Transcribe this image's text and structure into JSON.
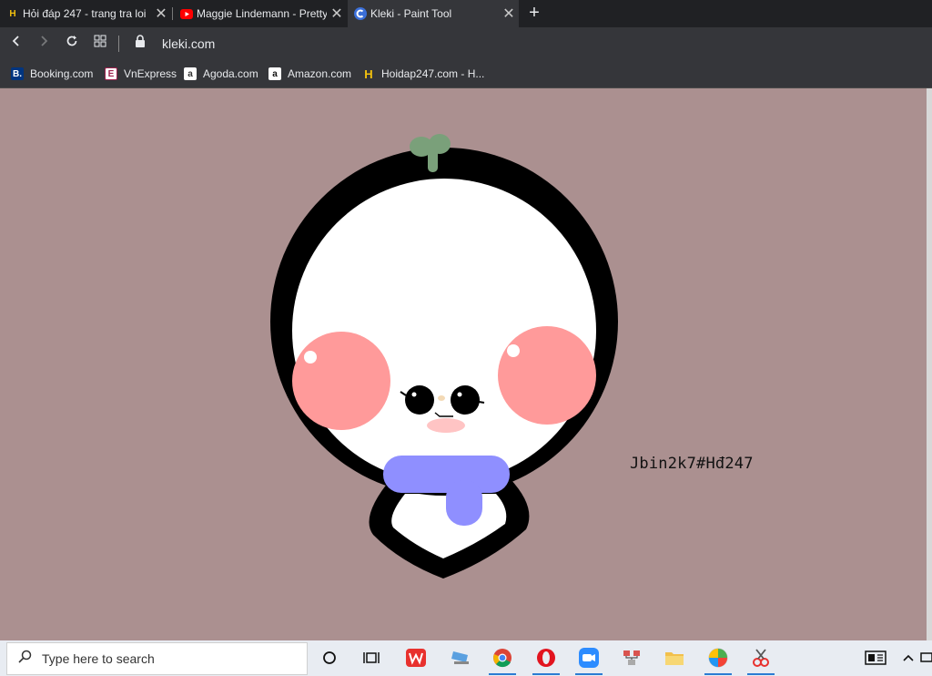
{
  "browser": {
    "tabs": [
      {
        "title": "Hỏi đáp 247 - trang tra loi",
        "favicon": "hoidap-icon",
        "active": false
      },
      {
        "title": "Maggie Lindemann - Pretty",
        "favicon": "youtube-icon",
        "active": false
      },
      {
        "title": "Kleki - Paint Tool",
        "favicon": "kleki-icon",
        "active": true
      }
    ],
    "new_tab_label": "+",
    "url": "kleki.com",
    "bookmarks": [
      {
        "label": "Booking.com",
        "icon": "booking-icon"
      },
      {
        "label": "VnExpress",
        "icon": "vnexpress-icon"
      },
      {
        "label": "Agoda.com",
        "icon": "agoda-icon"
      },
      {
        "label": "Amazon.com",
        "icon": "amazon-icon"
      },
      {
        "label": "Hoidap247.com - H...",
        "icon": "hoidap-icon"
      }
    ]
  },
  "drawing": {
    "signature": "Jbin2k7#Hđ247",
    "background_color": "#ab9090",
    "outline_color": "#000000",
    "cheek_color": "#ff9a9a",
    "scarf_color": "#8f8fff",
    "sprout_color": "#7aa07a"
  },
  "taskbar": {
    "search_placeholder": "Type here to search"
  }
}
